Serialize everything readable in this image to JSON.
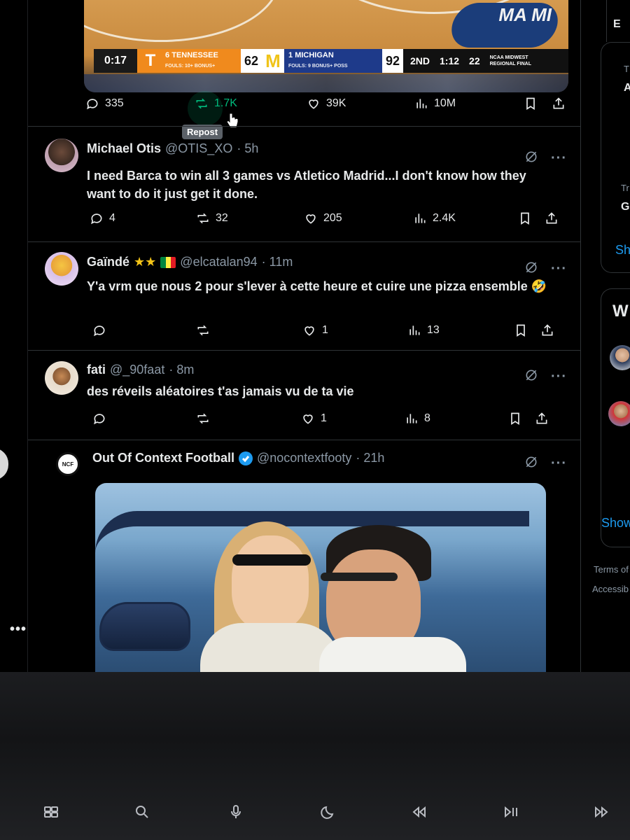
{
  "video": {
    "clock": "0:17",
    "team1": {
      "seed": "6",
      "name": "TENNESSEE",
      "fouls": "FOULS: 10+ BONUS+",
      "score": "62"
    },
    "team2": {
      "seed": "1",
      "name": "MICHIGAN",
      "fouls": "FOULS: 9  BONUS+  POSS",
      "score": "92"
    },
    "period": "2ND",
    "game_clock": "1:12",
    "shot_clock": "22",
    "event": "NCAA MIDWEST REGIONAL FINAL",
    "court_logo": "MA MI"
  },
  "top_actions": {
    "replies": "335",
    "reposts": "1.7K",
    "likes": "39K",
    "views": "10M",
    "tooltip": "Repost"
  },
  "posts": [
    {
      "name": "Michael Otis",
      "handle": "@OTIS_XO",
      "time": "· 5h",
      "text": "I need Barca to win all 3 games vs Atletico Madrid...I don't know how they want to do it just get it done.",
      "replies": "4",
      "reposts": "32",
      "likes": "205",
      "views": "2.4K"
    },
    {
      "name": "Gaïndé",
      "badges": "★★",
      "handle": "@elcatalan94",
      "time": "· 11m",
      "text": "Y'a vrm que nous 2 pour s'lever à cette heure et cuire une pizza ensemble 🤣",
      "replies": "",
      "reposts": "",
      "likes": "1",
      "views": "13"
    },
    {
      "name": "fati",
      "handle": "@_90faat",
      "time": "· 8m",
      "text": "des réveils aléatoires t'as jamais vu de ta vie",
      "replies": "",
      "reposts": "",
      "likes": "1",
      "views": "8"
    },
    {
      "name": "Out Of Context Football",
      "handle": "@nocontextfooty",
      "time": "· 21h",
      "avatar_text": "NCF"
    }
  ],
  "sidebar": {
    "frag1": "E",
    "frag2": "T",
    "frag3": "A",
    "frag4": "Tr",
    "frag5": "G",
    "show1": "Sh",
    "who_title": "W",
    "show2": "Show",
    "terms": "Terms of",
    "access": "Accessib"
  },
  "colors": {
    "background": "#000000",
    "accent_blue": "#1d9bf0",
    "repost_green": "#00ba7c",
    "muted": "#71767b"
  },
  "icons": [
    "reply-icon",
    "repost-icon",
    "like-icon",
    "views-icon",
    "bookmark-icon",
    "share-icon",
    "grok-icon",
    "more-icon",
    "verified-icon"
  ],
  "keyboard_keys": [
    "mission-control",
    "search",
    "dictation",
    "do-not-disturb",
    "rewind",
    "play-pause",
    "fast-forward"
  ]
}
